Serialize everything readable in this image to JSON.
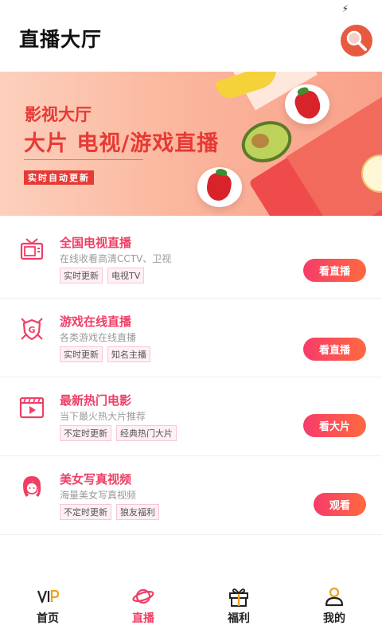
{
  "header": {
    "title": "直播大厅"
  },
  "banner": {
    "line1": "影视大厅",
    "line2": "大片 电视/游戏直播",
    "tag": "实时自动更新"
  },
  "items": [
    {
      "title": "全国电视直播",
      "subtitle": "在线收看高清CCTV、卫视",
      "tags": [
        "实时更新",
        "电视TV"
      ],
      "button": "看直播",
      "icon": "tv-icon"
    },
    {
      "title": "游戏在线直播",
      "subtitle": "各类游戏在线直播",
      "tags": [
        "实时更新",
        "知名主播"
      ],
      "button": "看直播",
      "icon": "game-shield-icon"
    },
    {
      "title": "最新热门电影",
      "subtitle": "当下最火热大片推荐",
      "tags": [
        "不定时更新",
        "经典热门大片"
      ],
      "button": "看大片",
      "icon": "film-icon"
    },
    {
      "title": "美女写真视频",
      "subtitle": "海量美女写真视频",
      "tags": [
        "不定时更新",
        "狼友福利"
      ],
      "button": "观看",
      "icon": "girl-icon"
    }
  ],
  "tabs": [
    {
      "label": "首页",
      "icon": "vip-icon",
      "active": false
    },
    {
      "label": "直播",
      "icon": "planet-icon",
      "active": true
    },
    {
      "label": "福利",
      "icon": "gift-icon",
      "active": false
    },
    {
      "label": "我的",
      "icon": "user-icon",
      "active": false
    }
  ],
  "colors": {
    "accent": "#f03e66",
    "button_start": "#f73b6a",
    "button_end": "#ff6a3f",
    "search_bg": "#e85a3f"
  }
}
